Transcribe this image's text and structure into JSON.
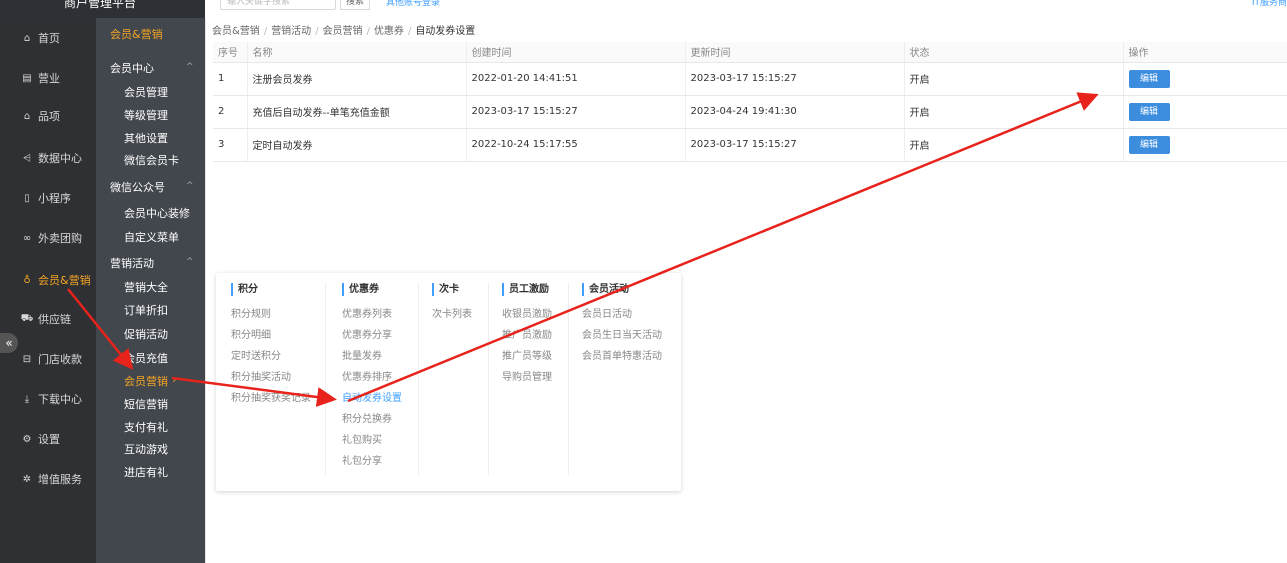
{
  "topbar": {
    "brand": "商户管理平台",
    "search_placeholder": "输入关键字搜索",
    "search_button": "搜索",
    "link": "其他账号登录",
    "right_text": "IT服务商"
  },
  "nav1": {
    "items": [
      {
        "label": "首页",
        "icon": "home-icon",
        "glyph": "⌂"
      },
      {
        "label": "营业",
        "icon": "calendar-icon",
        "glyph": "▤"
      },
      {
        "label": "品项",
        "icon": "bag-icon",
        "glyph": "⌂"
      },
      {
        "label": "数据中心",
        "icon": "share-icon",
        "glyph": "⩤"
      },
      {
        "label": "小程序",
        "icon": "phone-icon",
        "glyph": "▯"
      },
      {
        "label": "外卖团购",
        "icon": "link-icon",
        "glyph": "∞"
      },
      {
        "label": "会员&营销",
        "icon": "user-icon",
        "glyph": "♁"
      },
      {
        "label": "供应链",
        "icon": "truck-icon",
        "glyph": "⛟"
      },
      {
        "label": "门店收款",
        "icon": "wallet-icon",
        "glyph": "⊟"
      },
      {
        "label": "下载中心",
        "icon": "download-icon",
        "glyph": "⤓"
      },
      {
        "label": "设置",
        "icon": "gear-icon",
        "glyph": "⚙"
      },
      {
        "label": "增值服务",
        "icon": "gift-icon",
        "glyph": "✲"
      }
    ],
    "active_index": 6
  },
  "nav2": {
    "header": "会员&营销",
    "groups": [
      {
        "label": "会员中心",
        "items": [
          "会员管理",
          "等级管理",
          "其他设置",
          "微信会员卡"
        ]
      },
      {
        "label": "微信公众号",
        "items": [
          "会员中心装修",
          "自定义菜单"
        ]
      },
      {
        "label": "营销活动",
        "items": [
          "营销大全",
          "订单折扣",
          "促销活动",
          "会员充值",
          "会员营销",
          "短信营销",
          "支付有礼",
          "互动游戏",
          "进店有礼"
        ]
      }
    ],
    "active_item": "会员营销",
    "active_caret": "›",
    "caret_up": "^"
  },
  "breadcrumb": [
    "会员&营销",
    "营销活动",
    "会员营销",
    "优惠券",
    "自动发券设置"
  ],
  "table": {
    "headers": [
      "序号",
      "名称",
      "创建时间",
      "更新时间",
      "状态",
      "操作"
    ],
    "rows": [
      {
        "index": "1",
        "name": "注册会员发券",
        "created": "2022-01-20 14:41:51",
        "updated": "2023-03-17 15:15:27",
        "status": "开启",
        "action": "编辑"
      },
      {
        "index": "2",
        "name": "充值后自动发券--单笔充值金额",
        "created": "2023-03-17 15:15:27",
        "updated": "2023-04-24 19:41:30",
        "status": "开启",
        "action": "编辑"
      },
      {
        "index": "3",
        "name": "定时自动发券",
        "created": "2022-10-24 15:17:55",
        "updated": "2023-03-17 15:15:27",
        "status": "开启",
        "action": "编辑"
      }
    ]
  },
  "popup": {
    "columns": [
      {
        "title": "积分",
        "items": [
          "积分规则",
          "积分明细",
          "定时送积分",
          "积分抽奖活动",
          "积分抽奖获奖记录"
        ]
      },
      {
        "title": "优惠券",
        "items": [
          "优惠券列表",
          "优惠券分享",
          "批量发券",
          "优惠券排序",
          "自动发券设置",
          "积分兑换券",
          "礼包购买",
          "礼包分享"
        ],
        "highlight": "自动发券设置"
      },
      {
        "title": "次卡",
        "items": [
          "次卡列表"
        ]
      },
      {
        "title": "员工激励",
        "items": [
          "收银员激励",
          "推广员激励",
          "推广员等级",
          "导购员管理"
        ]
      },
      {
        "title": "会员活动",
        "items": [
          "会员日活动",
          "会员生日当天活动",
          "会员首单特惠活动"
        ]
      }
    ]
  },
  "colors": {
    "sidebar_dark": "#2f3034",
    "sidebar_sub": "#42464d",
    "accent_orange": "#f5a623",
    "accent_blue": "#409eff",
    "edit_button": "#3c8dde",
    "annotation_arrow": "#e8231b"
  },
  "collapse_glyph": "«"
}
